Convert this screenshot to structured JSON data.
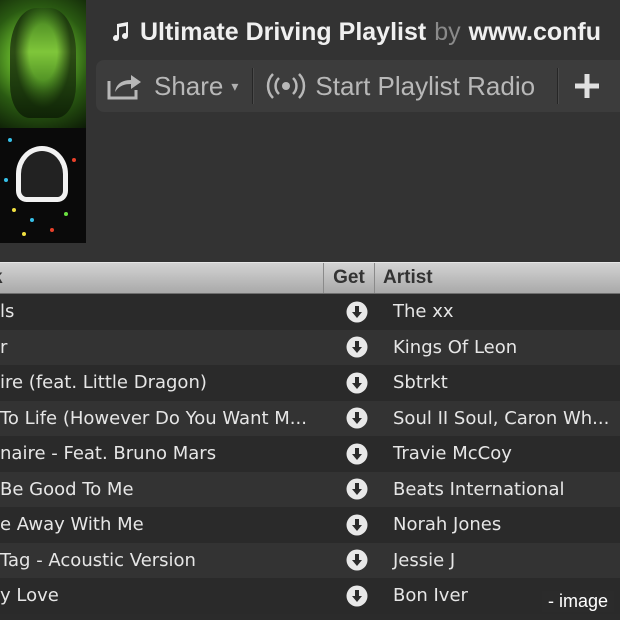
{
  "header": {
    "playlist_title": "Ultimate Driving Playlist",
    "by": "by",
    "owner": "www.confu",
    "note_icon": "music-note-icon"
  },
  "toolbar": {
    "share_label": "Share",
    "share_caret": "▾",
    "radio_label": "Start Playlist Radio",
    "add_label": "+"
  },
  "table": {
    "columns": {
      "track": "k",
      "get": "Get",
      "artist": "Artist"
    },
    "rows": [
      {
        "track": "ls",
        "artist": "The xx"
      },
      {
        "track": "r",
        "artist": "Kings Of Leon"
      },
      {
        "track": "ire (feat. Little Dragon)",
        "artist": "Sbtrkt"
      },
      {
        "track": "To Life (However Do You Want M...",
        "artist": "Soul II Soul, Caron Wh..."
      },
      {
        "track": "naire - Feat. Bruno Mars",
        "artist": "Travie McCoy"
      },
      {
        "track": "Be Good To Me",
        "artist": "Beats International"
      },
      {
        "track": "e Away With Me",
        "artist": "Norah Jones"
      },
      {
        "track": " Tag - Acoustic Version",
        "artist": "Jessie J"
      },
      {
        "track": "y Love",
        "artist": "Bon Iver"
      }
    ]
  },
  "watermark": "- image",
  "colors": {
    "background": "#2b2b2b",
    "toolbar": "#3c3c3c",
    "header_bar": "#bdbdbd"
  }
}
